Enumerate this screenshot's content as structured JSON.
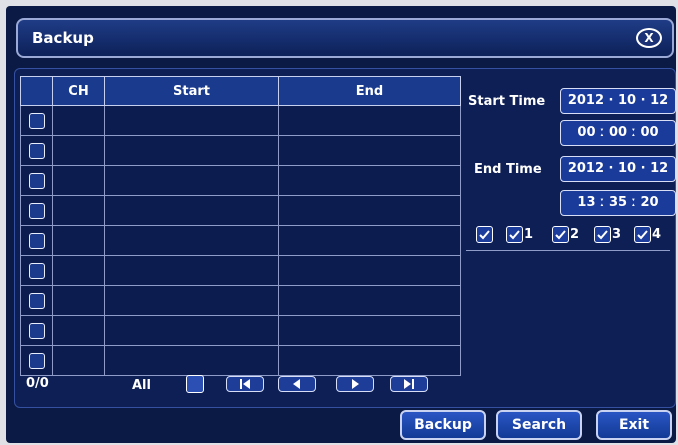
{
  "window": {
    "title": "Backup",
    "close_label": "X"
  },
  "table": {
    "headers": [
      "CH",
      "Start",
      "End"
    ],
    "rows": [
      {
        "ch": "",
        "start": "",
        "end": ""
      },
      {
        "ch": "",
        "start": "",
        "end": ""
      },
      {
        "ch": "",
        "start": "",
        "end": ""
      },
      {
        "ch": "",
        "start": "",
        "end": ""
      },
      {
        "ch": "",
        "start": "",
        "end": ""
      },
      {
        "ch": "",
        "start": "",
        "end": ""
      },
      {
        "ch": "",
        "start": "",
        "end": ""
      },
      {
        "ch": "",
        "start": "",
        "end": ""
      },
      {
        "ch": "",
        "start": "",
        "end": ""
      }
    ]
  },
  "pager": {
    "page_count": "0/0",
    "all_label": "All",
    "buttons": [
      "first-page",
      "previous-page",
      "next-page",
      "last-page"
    ]
  },
  "search": {
    "start_label": "Start  Time",
    "start_date": "2012 · 10 · 12",
    "start_time": "00 ː 00 ː 00",
    "end_label": "End  Time",
    "end_date": "2012 · 10 · 12",
    "end_time": "13 ː 35 ː 20",
    "channels": [
      "1",
      "2",
      "3",
      "4"
    ]
  },
  "actions": {
    "backup": "Backup",
    "search": "Search",
    "exit": "Exit"
  },
  "colors": {
    "background": "#0a1a44",
    "button": "#1b3b9a",
    "header": "#1a3a8e",
    "border": "#d7def5"
  }
}
